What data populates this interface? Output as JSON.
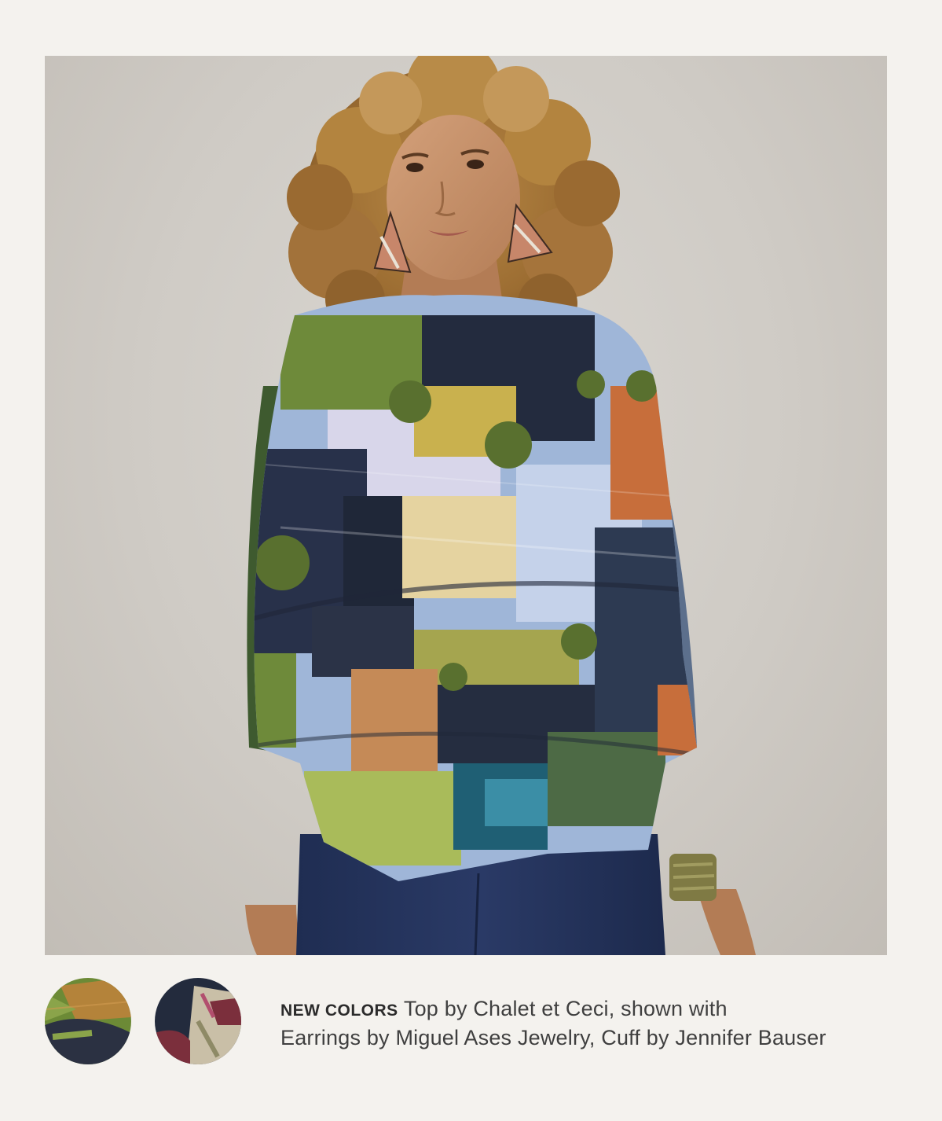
{
  "product_photo": {
    "alt": "Model wearing a multicolor crinkled top with jeans"
  },
  "color_swatches": [
    {
      "icon": "green-print-swatch-icon",
      "colors": [
        "#6c8a36",
        "#b4833a",
        "#2b3142"
      ]
    },
    {
      "icon": "navy-print-swatch-icon",
      "colors": [
        "#232b3d",
        "#7b2f3c",
        "#c9bfa7"
      ]
    }
  ],
  "caption": {
    "badge": "NEW COLORS",
    "line1": "Top by Chalet et Ceci, shown with",
    "line2": "Earrings by Miguel Ases Jewelry, Cuff by Jennifer Bauser"
  },
  "colors": {
    "background": "#f4f2ee",
    "photo_backdrop": "#d2cec8",
    "text": "#3f3f3f"
  }
}
